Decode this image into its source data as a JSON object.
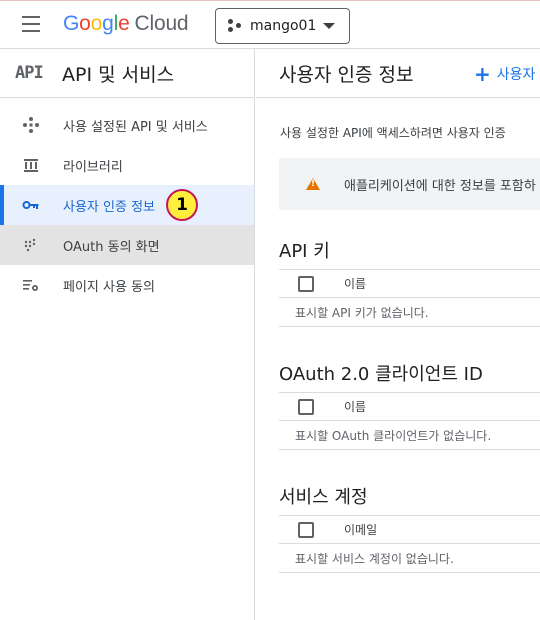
{
  "topbar": {
    "logo": {
      "G": "G",
      "o1": "o",
      "o2": "o",
      "g": "g",
      "l": "l",
      "e": "e",
      "cloud": "Cloud"
    },
    "project": "mango01"
  },
  "sidebar": {
    "api_logo": "API",
    "title": "API 및 서비스",
    "items": [
      {
        "label": "사용 설정된 API 및 서비스",
        "icon": "api-diamond-icon"
      },
      {
        "label": "라이브러리",
        "icon": "library-icon"
      },
      {
        "label": "사용자 인증 정보",
        "icon": "key-icon",
        "active": true
      },
      {
        "label": "OAuth 동의 화면",
        "icon": "consent-dots-icon"
      },
      {
        "label": "페이지 사용 동의",
        "icon": "settings-list-icon"
      }
    ],
    "badge": "1"
  },
  "main": {
    "title": "사용자 인증 정보",
    "create_button": "사용자 '",
    "description": "사용 설정한 API에 액세스하려면 사용자 인증",
    "notice": "애플리케이션에 대한 정보를 포함하",
    "sections": [
      {
        "title": "API 키",
        "column": "이름",
        "empty": "표시할 API 키가 없습니다."
      },
      {
        "title": "OAuth 2.0 클라이언트 ID",
        "column": "이름",
        "empty": "표시할 OAuth 클라이언트가 없습니다."
      },
      {
        "title": "서비스 계정",
        "column": "이메일",
        "empty": "표시할 서비스 계정이 없습니다."
      }
    ]
  },
  "colors": {
    "accent": "#1a73e8",
    "active_bg": "#e8f0fe",
    "badge": "#ffee3b",
    "warning": "#e37400"
  }
}
